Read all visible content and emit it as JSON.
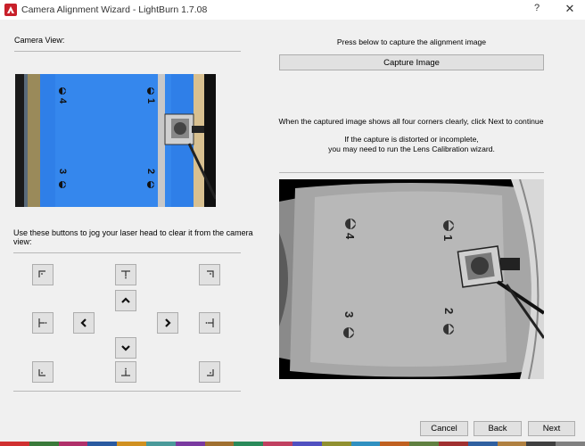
{
  "window": {
    "title": "Camera Alignment Wizard - LightBurn 1.7.08",
    "help_label": "?",
    "close_label": "✕"
  },
  "left": {
    "camera_view_label": "Camera View:",
    "jog_instructions_line1": "Use these buttons to jog your laser head to clear it from the camera",
    "jog_instructions_line2": "view:",
    "camera_markers": [
      "4",
      "1",
      "3",
      "2"
    ]
  },
  "right": {
    "capture_prompt": "Press below to capture the alignment image",
    "capture_button": "Capture Image",
    "info_line1": "When the captured image shows all four corners clearly, click Next to continue",
    "info_line2": "If the capture is distorted or incomplete,",
    "info_line3": "you may need to run the Lens Calibration wizard.",
    "capture_markers": [
      "4",
      "1",
      "3",
      "2"
    ]
  },
  "jog_buttons": [
    {
      "name": "jog-top-left-corner-button",
      "icon": "corner-top-left-icon"
    },
    {
      "name": "jog-top-center-button",
      "icon": "edge-top-icon"
    },
    {
      "name": "jog-top-right-corner-button",
      "icon": "corner-top-right-icon"
    },
    {
      "name": "jog-up-button",
      "icon": "chevron-up-icon"
    },
    {
      "name": "jog-left-edge-button",
      "icon": "edge-left-icon"
    },
    {
      "name": "jog-left-button",
      "icon": "chevron-left-icon"
    },
    {
      "name": "jog-right-button",
      "icon": "chevron-right-icon"
    },
    {
      "name": "jog-right-edge-button",
      "icon": "edge-right-icon"
    },
    {
      "name": "jog-down-button",
      "icon": "chevron-down-icon"
    },
    {
      "name": "jog-bottom-left-corner-button",
      "icon": "corner-bottom-left-icon"
    },
    {
      "name": "jog-bottom-center-button",
      "icon": "edge-bottom-icon"
    },
    {
      "name": "jog-bottom-right-corner-button",
      "icon": "corner-bottom-right-icon"
    }
  ],
  "footer": {
    "cancel_label": "Cancel",
    "back_label": "Back",
    "next_label": "Next"
  },
  "colors": {
    "camera_blue": "#2f7fe8",
    "title_icon_red": "#c8202a",
    "taskbar": [
      "#d03030",
      "#3a7a3a",
      "#b0306a",
      "#2a5aa0",
      "#d09020",
      "#4a9a9a",
      "#7a3aa0",
      "#a07030",
      "#2a8a5a",
      "#c04060",
      "#5050c0",
      "#909030",
      "#3090c0",
      "#c06020",
      "#608040",
      "#a03030",
      "#3060a0",
      "#b08040",
      "#404040",
      "#808080"
    ]
  }
}
